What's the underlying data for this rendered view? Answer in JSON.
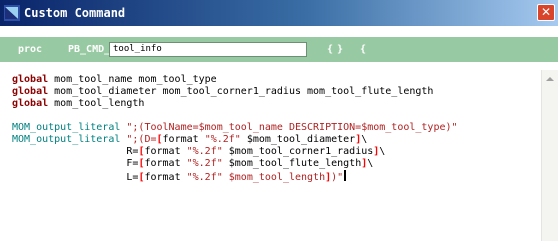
{
  "window": {
    "title": "Custom Command",
    "close_glyph": "✕"
  },
  "proc_header": {
    "keyword": "proc",
    "prefix": "PB_CMD_",
    "name_value": "tool_info",
    "open_brace": "{",
    "close_brace": "}",
    "open_brace2": "{"
  },
  "code": {
    "line1": {
      "kw": "global",
      "text": " mom_tool_name mom_tool_type"
    },
    "line2": {
      "kw": "global",
      "text": " mom_tool_diameter mom_tool_corner1_radius mom_tool_flute_length"
    },
    "line3": {
      "kw": "global",
      "text": " mom_tool_length"
    },
    "line4": {
      "func": "MOM_output_literal",
      "str": " \";(ToolName=$mom_tool_name DESCRIPTION=$mom_tool_type)\""
    },
    "line5": {
      "func": "MOM_output_literal",
      "str1": " \";(D=",
      "br1": "[",
      "fmt": "format ",
      "str2": "\"%.2f\"",
      "var": " $mom_tool_diameter",
      "br2": "]",
      "tail": "\\"
    },
    "line6": {
      "pre": "                   R=",
      "br1": "[",
      "fmt": "format ",
      "str2": "\"%.2f\"",
      "var": " $mom_tool_corner1_radius",
      "br2": "]",
      "tail": "\\"
    },
    "line7": {
      "pre": "                   F=",
      "br1": "[",
      "fmt": "format ",
      "str2": "\"%.2f\"",
      "var": " $mom_tool_flute_length",
      "br2": "]",
      "tail": "\\"
    },
    "line8": {
      "pre": "                   L=",
      "br1": "[",
      "fmt": "format ",
      "str2": "\"%.2f\"",
      "var": " $mom_tool_length",
      "br2": "]",
      "tail": ")\""
    }
  },
  "colors": {
    "title_bar": "#0a246a",
    "proc_bar": "#97c9a2",
    "keyword": "#8b0000",
    "function": "#008080",
    "string": "#b22222",
    "bracket": "#ff0000"
  },
  "icons": {
    "app": "nx-app-icon",
    "close": "close-icon",
    "scroll_up": "scroll-up-arrow-icon"
  }
}
